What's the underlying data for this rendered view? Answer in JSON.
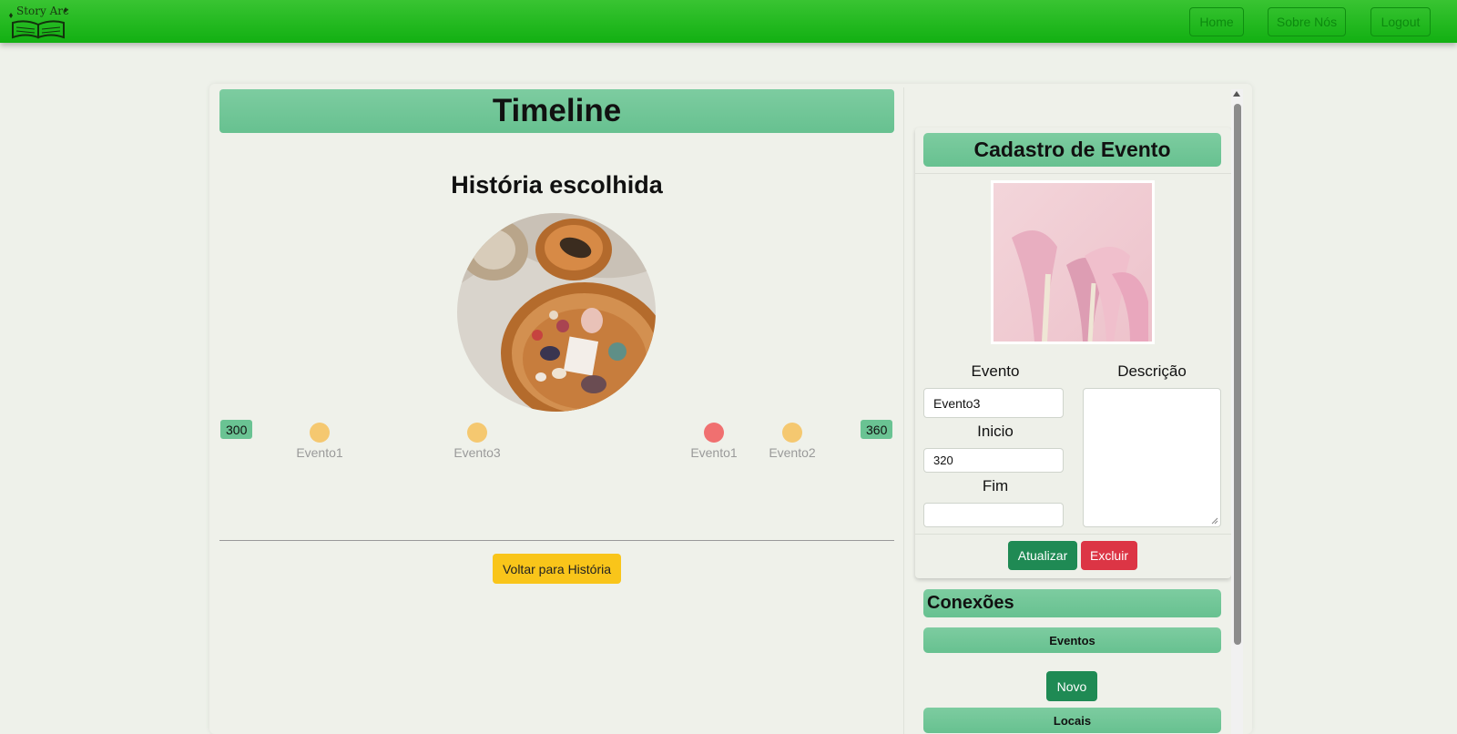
{
  "navbar": {
    "logo_text": "Story Arc",
    "home": "Home",
    "about": "Sobre Nós",
    "logout": "Logout"
  },
  "timeline": {
    "title": "Timeline",
    "story_title": "História escolhida",
    "range_start": "300",
    "range_end": "360",
    "events": [
      {
        "label": "Evento1",
        "color": "#f5c870"
      },
      {
        "label": "Evento3",
        "color": "#f5c870"
      },
      {
        "label": "Evento1",
        "color": "#f07070"
      },
      {
        "label": "Evento2",
        "color": "#f5c870"
      }
    ],
    "back_button": "Voltar para História"
  },
  "event_form": {
    "title": "Cadastro de Evento",
    "evento_label": "Evento",
    "evento_value": "Evento3",
    "descricao_label": "Descrição",
    "inicio_label": "Inicio",
    "inicio_value": "320",
    "fim_label": "Fim",
    "fim_value": "",
    "update_button": "Atualizar",
    "delete_button": "Excluir"
  },
  "connections": {
    "title": "Conexões",
    "events_header": "Eventos",
    "new_button": "Novo",
    "locations_header": "Locais"
  },
  "colors": {
    "navbar": "#1bb61b",
    "header_green": "#6fc595",
    "update_button": "#1f8a54",
    "delete_button": "#dc3545",
    "back_button": "#f9c51a"
  }
}
